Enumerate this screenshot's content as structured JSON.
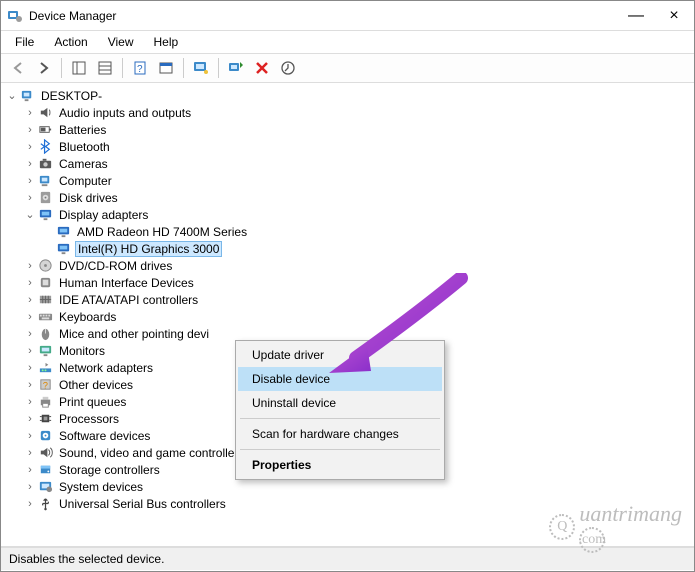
{
  "window": {
    "title": "Device Manager",
    "minimize": "—",
    "close": "×"
  },
  "menu": {
    "items": [
      "File",
      "Action",
      "View",
      "Help"
    ]
  },
  "toolbar_icons": [
    "back",
    "forward",
    "",
    "grid",
    "details",
    "",
    "help",
    "prop-sheet",
    "",
    "computer",
    "",
    "scan",
    "delete",
    "update"
  ],
  "tree": {
    "root": "DESKTOP-",
    "nodes": [
      {
        "label": "Audio inputs and outputs",
        "icon": "audio",
        "twisty": ">"
      },
      {
        "label": "Batteries",
        "icon": "battery",
        "twisty": ">"
      },
      {
        "label": "Bluetooth",
        "icon": "bluetooth",
        "twisty": ">"
      },
      {
        "label": "Cameras",
        "icon": "camera",
        "twisty": ">"
      },
      {
        "label": "Computer",
        "icon": "computer",
        "twisty": ">"
      },
      {
        "label": "Disk drives",
        "icon": "disk",
        "twisty": ">"
      },
      {
        "label": "Display adapters",
        "icon": "display",
        "twisty": "v",
        "children": [
          {
            "label": "AMD Radeon HD 7400M Series",
            "icon": "display"
          },
          {
            "label": "Intel(R) HD Graphics 3000",
            "icon": "display",
            "selected": true
          }
        ]
      },
      {
        "label": "DVD/CD-ROM drives",
        "icon": "optical",
        "twisty": ">"
      },
      {
        "label": "Human Interface Devices",
        "icon": "hid",
        "twisty": ">"
      },
      {
        "label": "IDE ATA/ATAPI controllers",
        "icon": "ide",
        "twisty": ">"
      },
      {
        "label": "Keyboards",
        "icon": "keyboard",
        "twisty": ">"
      },
      {
        "label": "Mice and other pointing devi",
        "icon": "mouse",
        "twisty": ">"
      },
      {
        "label": "Monitors",
        "icon": "monitor",
        "twisty": ">"
      },
      {
        "label": "Network adapters",
        "icon": "network",
        "twisty": ">"
      },
      {
        "label": "Other devices",
        "icon": "other",
        "twisty": ">"
      },
      {
        "label": "Print queues",
        "icon": "printer",
        "twisty": ">"
      },
      {
        "label": "Processors",
        "icon": "cpu",
        "twisty": ">"
      },
      {
        "label": "Software devices",
        "icon": "software",
        "twisty": ">"
      },
      {
        "label": "Sound, video and game controllers",
        "icon": "sound",
        "twisty": ">"
      },
      {
        "label": "Storage controllers",
        "icon": "storage",
        "twisty": ">"
      },
      {
        "label": "System devices",
        "icon": "system",
        "twisty": ">"
      },
      {
        "label": "Universal Serial Bus controllers",
        "icon": "usb",
        "twisty": ">"
      }
    ]
  },
  "context_menu": {
    "items": [
      {
        "label": "Update driver"
      },
      {
        "label": "Disable device",
        "highlight": true
      },
      {
        "label": "Uninstall device"
      },
      {
        "sep": true
      },
      {
        "label": "Scan for hardware changes"
      },
      {
        "sep": true
      },
      {
        "label": "Properties",
        "bold": true
      }
    ]
  },
  "status_text": "Disables the selected device.",
  "watermark": "Quantrimang.com"
}
